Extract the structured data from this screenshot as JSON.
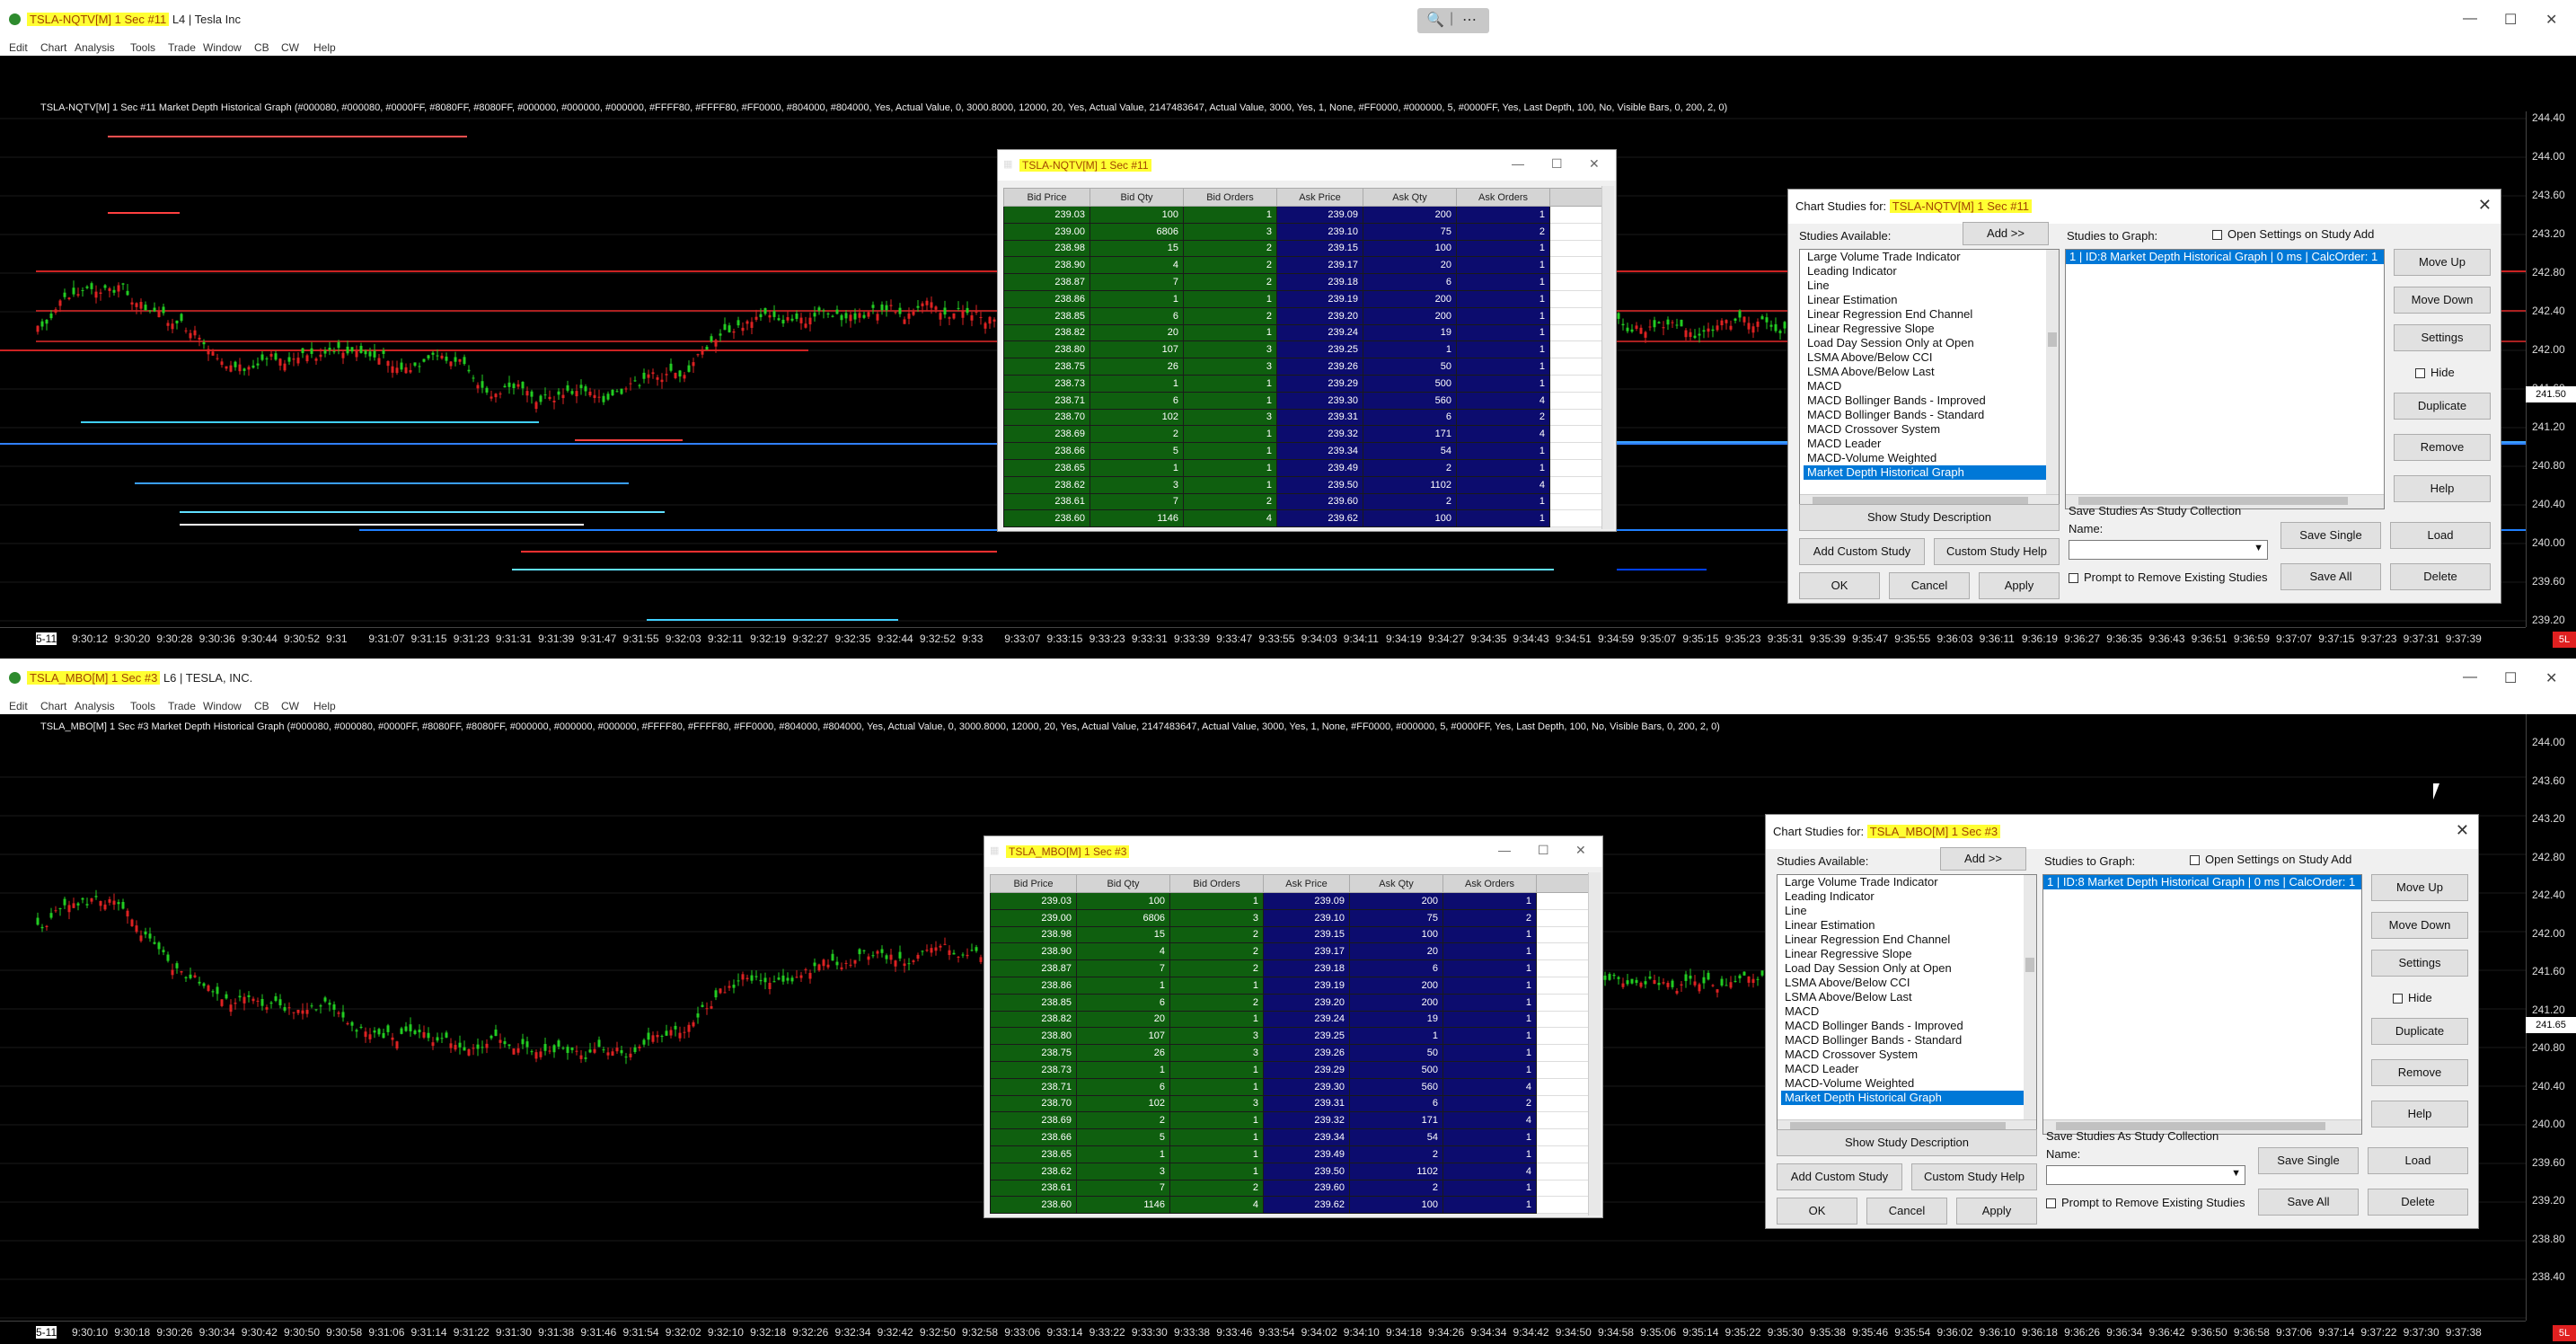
{
  "win1": {
    "title_hl": "TSLA-NQTV[M]  1 Sec  #11",
    "title_rest": " L4 | Tesla Inc",
    "study_line": "TSLA-NQTV[M]  1 Sec  #11 Market Depth Historical Graph  (#000080, #000080, #0000FF, #8080FF, #8080FF, #000000, #000000, #000000, #FFFF80, #FFFF80, #FF0000, #804000, #804000, Yes, Actual Value, 0, 3000.8000, 12000, 20, Yes, Actual Value, 2147483647, Actual Value, 3000, Yes, 1, None, #FF0000, #000000, 5, #0000FF, Yes, Last Depth, 100, No, Visible Bars, 0, 200, 2, 0)",
    "y_labels": [
      "244.40",
      "244.00",
      "243.60",
      "243.20",
      "242.80",
      "242.40",
      "242.00",
      "241.60",
      "241.20",
      "240.80",
      "240.40",
      "240.00",
      "239.60",
      "239.20"
    ],
    "price_badge": "241.50",
    "x_labels": [
      "9:30:12",
      "9:30:20",
      "9:30:28",
      "9:30:36",
      "9:30:44",
      "9:30:52",
      "9:31",
      "9:31:07",
      "9:31:15",
      "9:31:23",
      "9:31:31",
      "9:31:39",
      "9:31:47",
      "9:31:55",
      "9:32:03",
      "9:32:11",
      "9:32:19",
      "9:32:27",
      "9:32:35",
      "9:32:44",
      "9:32:52",
      "9:33",
      "9:33:07",
      "9:33:15",
      "9:33:23",
      "9:33:31",
      "9:33:39",
      "9:33:47",
      "9:33:55",
      "9:34:03",
      "9:34:11",
      "9:34:19",
      "9:34:27",
      "9:34:35",
      "9:34:43",
      "9:34:51",
      "9:34:59",
      "9:35:07",
      "9:35:15",
      "9:35:23",
      "9:35:31",
      "9:35:39",
      "9:35:47",
      "9:35:55",
      "9:36:03",
      "9:36:11",
      "9:36:19",
      "9:36:27",
      "9:36:35",
      "9:36:43",
      "9:36:51",
      "9:36:59",
      "9:37:07",
      "9:37:15",
      "9:37:23",
      "9:37:31",
      "9:37:39"
    ],
    "x_first": "5-11",
    "last_badge": "5L"
  },
  "win2": {
    "title_hl": "TSLA_MBO[M]  1 Sec  #3",
    "title_rest": " L6 | TESLA, INC.",
    "study_line": "TSLA_MBO[M]  1 Sec  #3 Market Depth Historical Graph  (#000080, #000080, #0000FF, #8080FF, #8080FF, #000000, #000000, #000000, #FFFF80, #FFFF80, #FF0000, #804000, #804000, Yes, Actual Value, 0, 3000.8000, 12000, 20, Yes, Actual Value, 2147483647, Actual Value, 3000, Yes, 1, None, #FF0000, #000000, 5, #0000FF, Yes, Last Depth, 100, No, Visible Bars, 0, 200, 2, 0)",
    "y_labels": [
      "244.00",
      "243.60",
      "243.20",
      "242.80",
      "242.40",
      "242.00",
      "241.60",
      "241.20",
      "240.80",
      "240.40",
      "240.00",
      "239.60",
      "239.20",
      "238.80",
      "238.40"
    ],
    "price_badge": "241.65",
    "x_labels": [
      "9:30:10",
      "9:30:18",
      "9:30:26",
      "9:30:34",
      "9:30:42",
      "9:30:50",
      "9:30:58",
      "9:31:06",
      "9:31:14",
      "9:31:22",
      "9:31:30",
      "9:31:38",
      "9:31:46",
      "9:31:54",
      "9:32:02",
      "9:32:10",
      "9:32:18",
      "9:32:26",
      "9:32:34",
      "9:32:42",
      "9:32:50",
      "9:32:58",
      "9:33:06",
      "9:33:14",
      "9:33:22",
      "9:33:30",
      "9:33:38",
      "9:33:46",
      "9:33:54",
      "9:34:02",
      "9:34:10",
      "9:34:18",
      "9:34:26",
      "9:34:34",
      "9:34:42",
      "9:34:50",
      "9:34:58",
      "9:35:06",
      "9:35:14",
      "9:35:22",
      "9:35:30",
      "9:35:38",
      "9:35:46",
      "9:35:54",
      "9:36:02",
      "9:36:10",
      "9:36:18",
      "9:36:26",
      "9:36:34",
      "9:36:42",
      "9:36:50",
      "9:36:58",
      "9:37:06",
      "9:37:14",
      "9:37:22",
      "9:37:30",
      "9:37:38"
    ],
    "x_first": "5-11",
    "last_badge": "5L"
  },
  "menu": [
    "Edit",
    "Chart",
    "Analysis",
    "Tools",
    "Trade",
    "Window",
    "CB",
    "CW",
    "Help"
  ],
  "dom1": {
    "title": "TSLA-NQTV[M]  1 Sec  #11"
  },
  "dom2": {
    "title": "TSLA_MBO[M]  1 Sec  #3"
  },
  "dom_headers": [
    "Bid Price",
    "Bid Qty",
    "Bid Orders",
    "Ask Price",
    "Ask Qty",
    "Ask Orders"
  ],
  "dom_rows": [
    [
      "239.03",
      "100",
      "1",
      "239.09",
      "200",
      "1"
    ],
    [
      "239.00",
      "6806",
      "3",
      "239.10",
      "75",
      "2"
    ],
    [
      "238.98",
      "15",
      "2",
      "239.15",
      "100",
      "1"
    ],
    [
      "238.90",
      "4",
      "2",
      "239.17",
      "20",
      "1"
    ],
    [
      "238.87",
      "7",
      "2",
      "239.18",
      "6",
      "1"
    ],
    [
      "238.86",
      "1",
      "1",
      "239.19",
      "200",
      "1"
    ],
    [
      "238.85",
      "6",
      "2",
      "239.20",
      "200",
      "1"
    ],
    [
      "238.82",
      "20",
      "1",
      "239.24",
      "19",
      "1"
    ],
    [
      "238.80",
      "107",
      "3",
      "239.25",
      "1",
      "1"
    ],
    [
      "238.75",
      "26",
      "3",
      "239.26",
      "50",
      "1"
    ],
    [
      "238.73",
      "1",
      "1",
      "239.29",
      "500",
      "1"
    ],
    [
      "238.71",
      "6",
      "1",
      "239.30",
      "560",
      "4"
    ],
    [
      "238.70",
      "102",
      "3",
      "239.31",
      "6",
      "2"
    ],
    [
      "238.69",
      "2",
      "1",
      "239.32",
      "171",
      "4"
    ],
    [
      "238.66",
      "5",
      "1",
      "239.34",
      "54",
      "1"
    ],
    [
      "238.65",
      "1",
      "1",
      "239.49",
      "2",
      "1"
    ],
    [
      "238.62",
      "3",
      "1",
      "239.50",
      "1102",
      "4"
    ],
    [
      "238.61",
      "7",
      "2",
      "239.60",
      "2",
      "1"
    ],
    [
      "238.60",
      "1146",
      "4",
      "239.62",
      "100",
      "1"
    ]
  ],
  "dlg1": {
    "title_prefix": "Chart Studies for: ",
    "title_hl": "TSLA-NQTV[M]  1 Sec  #11",
    "graph_item": "1 | ID:8  Market Depth Historical Graph | 0 ms | CalcOrder: 1"
  },
  "dlg2": {
    "title_prefix": "Chart Studies for: ",
    "title_hl": "TSLA_MBO[M]  1 Sec  #3",
    "graph_item": "1 | ID:8  Market Depth Historical Graph | 0 ms | CalcOrder: 1"
  },
  "dlg_common": {
    "studies_available": "Studies Available:",
    "add": "Add >>",
    "studies_to_graph": "Studies to Graph:",
    "open_settings": "Open Settings on Study Add",
    "available_items": [
      "Large Volume Trade Indicator",
      "Leading Indicator",
      "Line",
      "Linear Estimation",
      "Linear Regression End Channel",
      "Linear Regressive Slope",
      "Load Day Session Only at Open",
      "LSMA Above/Below CCI",
      "LSMA Above/Below Last",
      "MACD",
      "MACD Bollinger Bands - Improved",
      "MACD Bollinger Bands - Standard",
      "MACD Crossover System",
      "MACD Leader",
      "MACD-Volume Weighted",
      "Market Depth Historical Graph"
    ],
    "move_up": "Move Up",
    "move_down": "Move Down",
    "settings": "Settings",
    "hide": "Hide",
    "duplicate": "Duplicate",
    "remove": "Remove",
    "help": "Help",
    "show_desc": "Show Study Description",
    "add_custom": "Add Custom Study",
    "custom_help": "Custom Study Help",
    "save_collection": "Save Studies As Study Collection",
    "name": "Name:",
    "save_single": "Save Single",
    "load": "Load",
    "save_all": "Save All",
    "delete": "Delete",
    "prompt_remove": "Prompt to Remove Existing Studies",
    "ok": "OK",
    "cancel": "Cancel",
    "apply": "Apply"
  }
}
